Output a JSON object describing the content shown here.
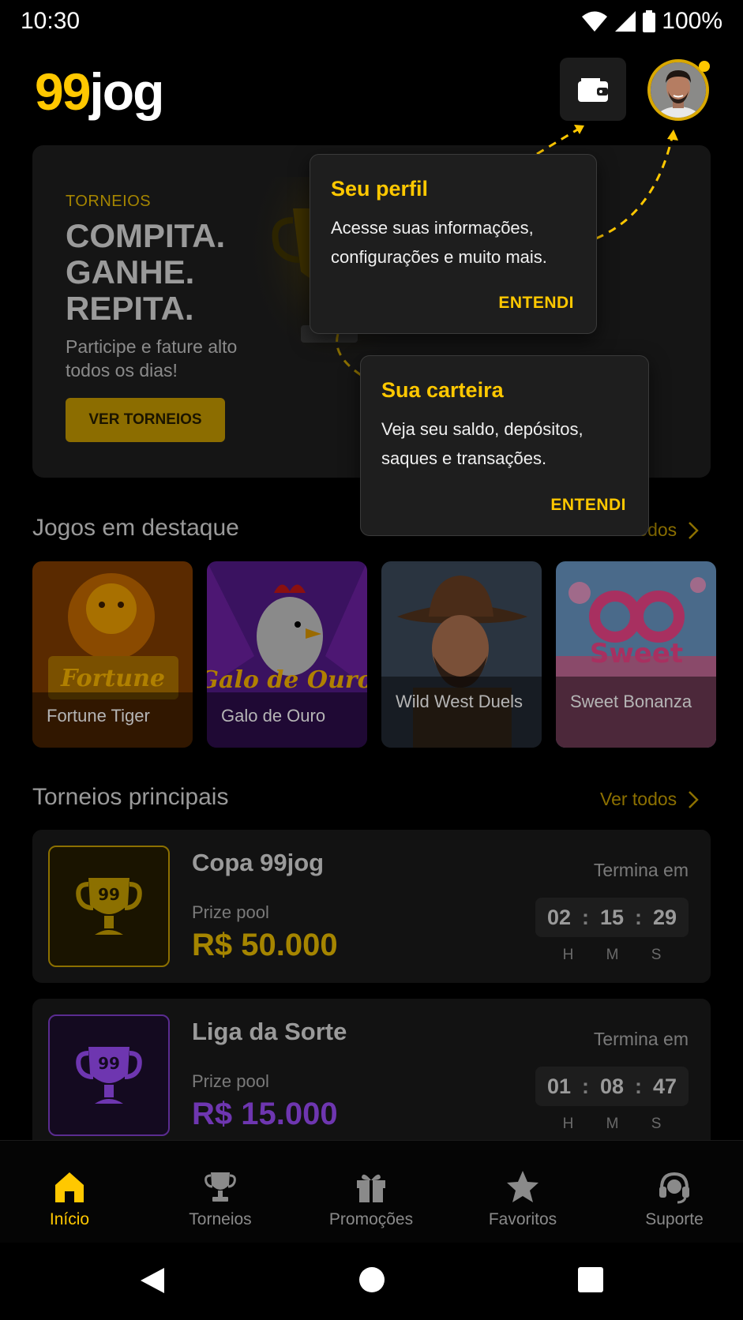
{
  "status_bar": {
    "time": "10:30",
    "battery": "100%",
    "icons": [
      "wifi-icon",
      "signal-icon",
      "battery-icon"
    ]
  },
  "header": {
    "logo_part1": "99",
    "logo_part2": "jog",
    "wallet_icon": "wallet-icon",
    "avatar": "user-avatar"
  },
  "hero": {
    "label": "TORNEIOS",
    "title_line1": "COMPITA.",
    "title_line2": "GANHE.",
    "title_line3": "REPITA.",
    "subtitle": "Participe e fature alto todos os dias!",
    "button": "VER TORNEIOS"
  },
  "popovers": [
    {
      "title": "Seu perfil",
      "body": "Acesse suas informações, configurações e muito mais.",
      "action": "ENTENDI"
    },
    {
      "title": "Sua carteira",
      "body": "Veja seu saldo, depósitos, saques e transações.",
      "action": "ENTENDI"
    }
  ],
  "featured": {
    "title": "Jogos em destaque",
    "see_all": "Ver todos",
    "games": [
      {
        "name": "Fortune Tiger"
      },
      {
        "name": "Galo de Ouro"
      },
      {
        "name": "Wild West Duels"
      },
      {
        "name": "Sweet Bonanza"
      }
    ]
  },
  "tournaments": {
    "title": "Torneios principais",
    "see_all": "Ver todos",
    "items": [
      {
        "name": "Copa 99jog",
        "prize_label": "Prize pool",
        "prize": "R$ 50.000",
        "ends_label": "Termina em",
        "h": "02",
        "m": "15",
        "s": "29",
        "color": "#A58500"
      },
      {
        "name": "Liga da Sorte",
        "prize_label": "Prize pool",
        "prize": "R$ 15.000",
        "ends_label": "Termina em",
        "h": "01",
        "m": "08",
        "s": "47",
        "color": "#6E36B0"
      }
    ],
    "units": {
      "h": "H",
      "m": "M",
      "s": "S"
    }
  },
  "bottom_nav": [
    {
      "label": "Início",
      "icon": "home-icon",
      "active": true
    },
    {
      "label": "Torneios",
      "icon": "trophy-icon",
      "active": false
    },
    {
      "label": "Promoções",
      "icon": "gift-icon",
      "active": false
    },
    {
      "label": "Favoritos",
      "icon": "star-icon",
      "active": false
    },
    {
      "label": "Suporte",
      "icon": "headset-icon",
      "active": false
    }
  ],
  "colors": {
    "accent": "#FFC800",
    "background": "#000000",
    "purple": "#6E36B0"
  }
}
